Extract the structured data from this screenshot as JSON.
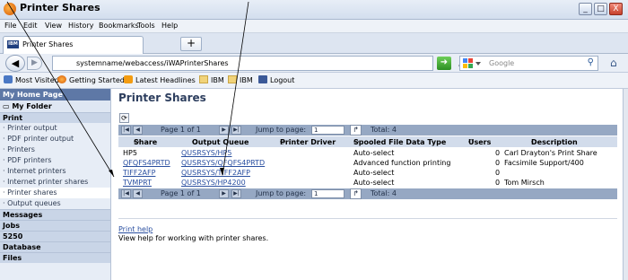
{
  "window": {
    "title": "Printer Shares",
    "controls": [
      "_",
      "□",
      "X"
    ]
  },
  "menu": [
    "File",
    "Edit",
    "View",
    "History",
    "Bookmarks",
    "Tools",
    "Help"
  ],
  "tab": {
    "label": "Printer Shares",
    "favicon": "IBM",
    "new_tab": "+"
  },
  "nav": {
    "url": "systemname/webaccess/iWAPrinterShares",
    "search_engine": "Google",
    "search_placeholder": "Google"
  },
  "bookmarks": [
    {
      "label": "Most Visited",
      "icon": "bookmark-star-icon"
    },
    {
      "label": "Getting Started",
      "icon": "firefox-icon"
    },
    {
      "label": "Latest Headlines",
      "icon": "rss-icon"
    },
    {
      "label": "IBM",
      "icon": "folder-icon"
    },
    {
      "label": "IBM",
      "icon": "folder-icon"
    },
    {
      "label": "Logout",
      "icon": "facebook-icon"
    }
  ],
  "sidebar": {
    "home": "My Home Page",
    "folder": "My Folder",
    "print_cat": "Print",
    "print_items": [
      "Printer output",
      "PDF printer output",
      "Printers",
      "PDF printers",
      "Internet printers",
      "Internet printer shares",
      "Printer shares",
      "Output queues"
    ],
    "other_cats": [
      "Messages",
      "Jobs",
      "5250",
      "Database",
      "Files"
    ]
  },
  "main": {
    "title": "Printer Shares",
    "pager": {
      "page_label": "Page 1 of 1",
      "jump_label": "Jump to page:",
      "jump_value": "1",
      "total": "Total: 4"
    },
    "columns": [
      "Share",
      "Output Queue",
      "Printer Driver",
      "Spooled File Data Type",
      "Users",
      "Description"
    ],
    "rows": [
      {
        "share": "HP5",
        "queue": "QUSRSYS/HP5",
        "driver": "",
        "type": "Auto-select",
        "users": "0",
        "desc": "Carl Drayton's Print Share"
      },
      {
        "share": "QFQFS4PRTD",
        "queue": "QUSRSYS/QFQFS4PRTD",
        "driver": "",
        "type": "Advanced function printing",
        "users": "0",
        "desc": "Facsimile Support/400"
      },
      {
        "share": "TIFF2AFP",
        "queue": "QUSRSYS/TIFF2AFP",
        "driver": "",
        "type": "Auto-select",
        "users": "0",
        "desc": ""
      },
      {
        "share": "TVMPRT",
        "queue": "QUSRSYS/HP4200",
        "driver": "",
        "type": "Auto-select",
        "users": "0",
        "desc": "Tom Mirsch"
      }
    ],
    "help_link": "Print help",
    "help_text": "View help for working with printer shares."
  },
  "colors": {
    "sidebar_head": "#5e78a6",
    "pager": "#96a8c3",
    "link": "#2a4fa0"
  }
}
